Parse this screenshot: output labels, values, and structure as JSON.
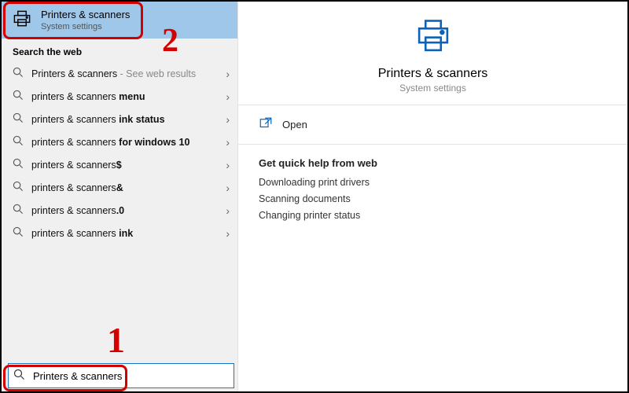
{
  "annotations": {
    "num1": "1",
    "num2": "2"
  },
  "top_match": {
    "title": "Printers & scanners",
    "subtitle": "System settings"
  },
  "section_label": "Search the web",
  "results": [
    {
      "prefix": "Printers & scanners",
      "suffix": "",
      "hint": " - See web results"
    },
    {
      "prefix": "printers & scanners ",
      "suffix": "menu",
      "hint": ""
    },
    {
      "prefix": "printers & scanners ",
      "suffix": "ink status",
      "hint": ""
    },
    {
      "prefix": "printers & scanners ",
      "suffix": "for windows 10",
      "hint": ""
    },
    {
      "prefix": "printers & scanners",
      "suffix": "$",
      "hint": ""
    },
    {
      "prefix": "printers & scanners",
      "suffix": "&",
      "hint": ""
    },
    {
      "prefix": "printers & scanners",
      "suffix": ".0",
      "hint": ""
    },
    {
      "prefix": "printers & scanners ",
      "suffix": "ink",
      "hint": ""
    }
  ],
  "search": {
    "value": "Printers & scanners"
  },
  "detail": {
    "title": "Printers & scanners",
    "subtitle": "System settings",
    "open_label": "Open",
    "help_header": "Get quick help from web",
    "help_links": [
      "Downloading print drivers",
      "Scanning documents",
      "Changing printer status"
    ]
  },
  "colors": {
    "accent": "#1979c9"
  }
}
